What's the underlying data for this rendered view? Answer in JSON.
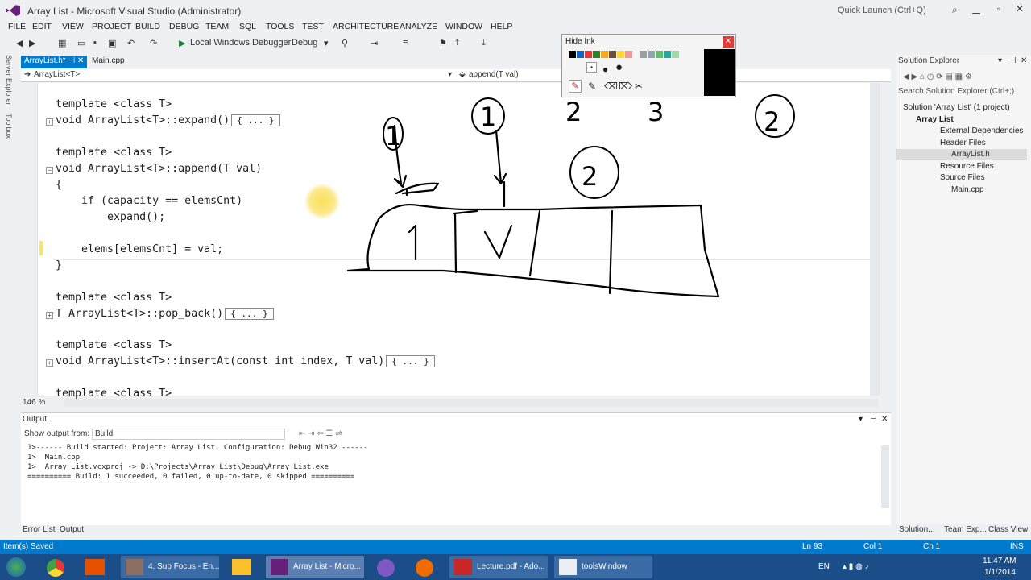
{
  "title_bar": {
    "title": "Array List - Microsoft Visual Studio (Administrator)",
    "quick_launch_placeholder": "Quick Launch (Ctrl+Q)"
  },
  "menu": [
    "FILE",
    "EDIT",
    "VIEW",
    "PROJECT",
    "BUILD",
    "DEBUG",
    "TEAM",
    "SQL",
    "TOOLS",
    "TEST",
    "ARCHITECTURE",
    "ANALYZE",
    "WINDOW",
    "HELP"
  ],
  "toolbar": {
    "debugger": "Local Windows Debugger",
    "config": "Debug"
  },
  "side_tabs": [
    "Server Explorer",
    "Toolbox"
  ],
  "editor_tabs": [
    {
      "label": "ArrayList.h*",
      "active": true
    },
    {
      "label": "Main.cpp",
      "active": false
    }
  ],
  "nav": {
    "scope": "ArrayList<T>",
    "member": "append(T val)"
  },
  "code": {
    "l1": "template <class T>",
    "l2": "void ArrayList<T>::expand()",
    "l2b": "{ ... }",
    "l3": "template <class T>",
    "l4": "void ArrayList<T>::append(T val)",
    "l5": "{",
    "l6": "    if (capacity == elemsCnt)",
    "l7": "        expand();",
    "l8": "    elems[elemsCnt] = val;",
    "l9": "}",
    "l10": "template <class T>",
    "l11": "T ArrayList<T>::pop_back()",
    "l11b": "{ ... }",
    "l12": "template <class T>",
    "l13": "void ArrayList<T>::insertAt(const int index, T val)",
    "l13b": "{ ... }",
    "l14": "template <class T>"
  },
  "zoom": "146 %",
  "ink_toolbar": {
    "title": "Hide Ink",
    "colors": [
      "#000000",
      "#1565c0",
      "#e53935",
      "#2e7d32",
      "#f9a825",
      "#6d4c41",
      "#fdd835",
      "#ef9a9a",
      "#9e9e9e",
      "#90a4ae",
      "#66bb6a",
      "#26a69a",
      "#a5d6a7"
    ]
  },
  "solution_explorer": {
    "title": "Solution Explorer",
    "search_placeholder": "Search Solution Explorer (Ctrl+;)",
    "nodes": [
      {
        "label": "Solution 'Array List' (1 project)",
        "indent": 0
      },
      {
        "label": "Array List",
        "indent": 1
      },
      {
        "label": "External Dependencies",
        "indent": 2
      },
      {
        "label": "Header Files",
        "indent": 2
      },
      {
        "label": "ArrayList.h",
        "indent": 3
      },
      {
        "label": "Resource Files",
        "indent": 2
      },
      {
        "label": "Source Files",
        "indent": 2
      },
      {
        "label": "Main.cpp",
        "indent": 3
      }
    ],
    "tabs": [
      "Solution...",
      "Team Exp...",
      "Class View"
    ]
  },
  "output": {
    "title": "Output",
    "source_label": "Show output from:",
    "source_value": "Build",
    "lines": [
      "1>------ Build started: Project: Array List, Configuration: Debug Win32 ------",
      "1>  Main.cpp",
      "1>  Array List.vcxproj -> D:\\Projects\\Array List\\Debug\\Array List.exe",
      "========== Build: 1 succeeded, 0 failed, 0 up-to-date, 0 skipped =========="
    ]
  },
  "bottom_tabs": [
    "Error List",
    "Output"
  ],
  "status": {
    "message": "Item(s) Saved",
    "ln": "Ln 93",
    "col": "Col 1",
    "ch": "Ch 1",
    "mode": "INS"
  },
  "taskbar": {
    "items": [
      "4. Sub Focus - En...",
      "Array List - Micro...",
      "Lecture.pdf - Ado...",
      "toolsWindow"
    ],
    "lang": "EN",
    "time": "11:47 AM",
    "date": "1/1/2014"
  },
  "handwriting": [
    "1",
    "2",
    "3",
    "2",
    "1",
    "1",
    "2"
  ]
}
